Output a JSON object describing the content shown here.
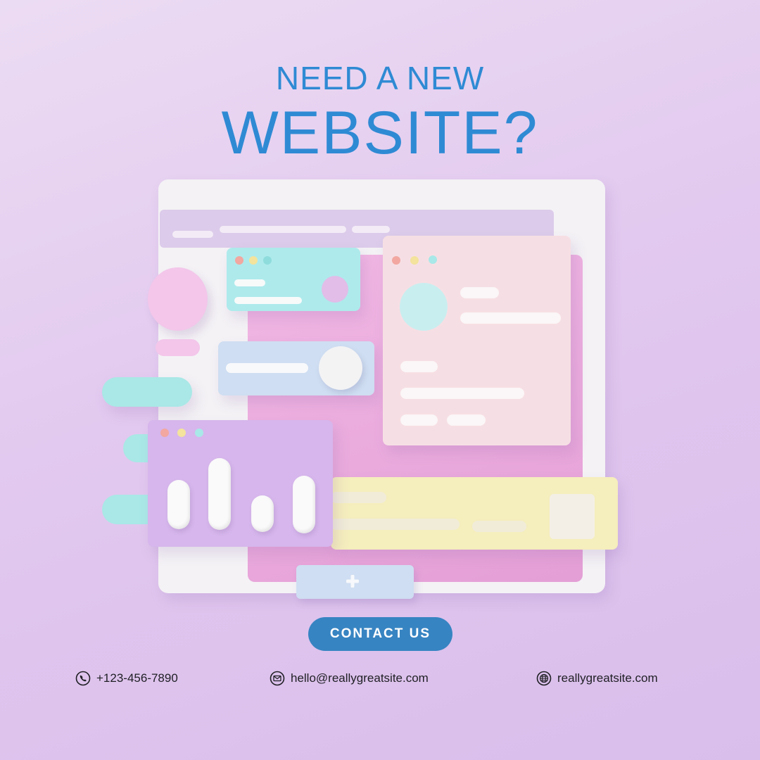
{
  "heading": {
    "line1": "NEED A NEW",
    "line2": "WEBSITE?"
  },
  "cta": {
    "label": "CONTACT US"
  },
  "contacts": {
    "phone": {
      "icon": "phone-icon",
      "text": "+123-456-7890"
    },
    "email": {
      "icon": "mail-icon",
      "text": "hello@reallygreatsite.com"
    },
    "website": {
      "icon": "globe-icon",
      "text": "reallygreatsite.com"
    }
  },
  "colors": {
    "heading": "#2f8ad4",
    "cta_bg": "#3784c2",
    "cta_text": "#ffffff",
    "card_cyan": "#aeeaec",
    "card_pink": "#f6dfe4",
    "card_purple": "#d6b6ec",
    "card_yellow": "#f5eebd",
    "card_blue": "#cfdef2",
    "panel_magenta": "#eba7dc"
  }
}
